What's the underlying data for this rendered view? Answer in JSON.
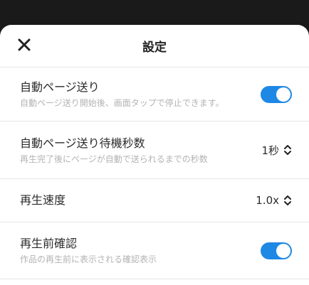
{
  "header": {
    "title": "設定"
  },
  "settings": {
    "auto_page": {
      "label": "自動ページ送り",
      "description": "自動ページ送り開始後、画面タップで停止できます。",
      "enabled": true
    },
    "auto_page_wait": {
      "label": "自動ページ送り待機秒数",
      "description": "再生完了後にページが自動で送られるまでの秒数",
      "value": "1秒"
    },
    "playback_speed": {
      "label": "再生速度",
      "value": "1.0x"
    },
    "preplay_confirm": {
      "label": "再生前確認",
      "description": "作品の再生前に表示される確認表示",
      "enabled": true
    }
  },
  "colors": {
    "accent": "#1e88e5",
    "backdrop": "#1a1a1a",
    "divider": "#e6e6e6",
    "secondary_text": "#b3b3b3"
  },
  "icons": {
    "close": "close-icon",
    "stepper": "chevron-up-down-icon"
  }
}
